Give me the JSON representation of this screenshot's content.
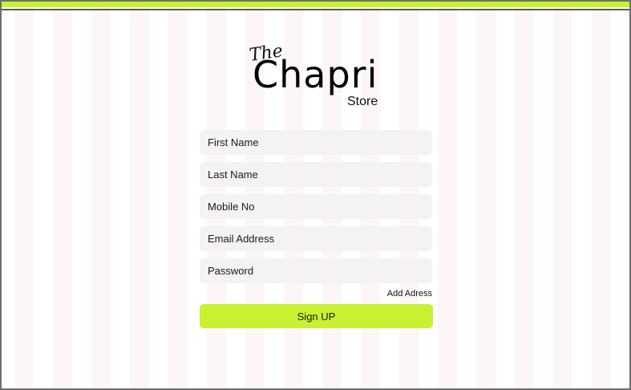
{
  "brand": {
    "the": "The",
    "main": "Chapri",
    "store": "Store"
  },
  "form": {
    "first_name_placeholder": "First Name",
    "last_name_placeholder": "Last Name",
    "mobile_placeholder": "Mobile No",
    "email_placeholder": "Email Address",
    "password_placeholder": "Password",
    "add_address_label": "Add Adress",
    "signup_label": "Sign UP"
  },
  "colors": {
    "accent": "#c8f131",
    "field_bg": "#f4f2f2"
  }
}
